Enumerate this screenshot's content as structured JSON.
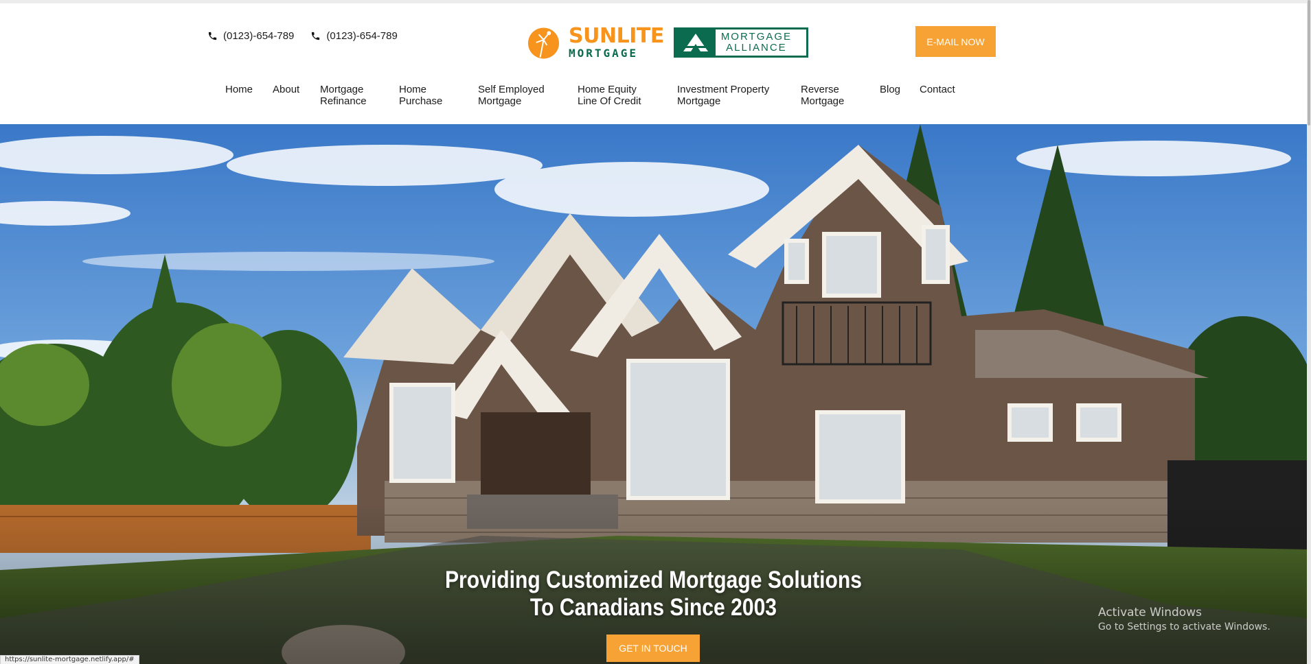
{
  "topbar": {
    "phones": [
      "(0123)-654-789",
      "(0123)-654-789"
    ],
    "logo": {
      "name_top": "SUNLITE",
      "name_bottom": "MORTGAGE",
      "partner_line1": "MORTGAGE",
      "partner_line2": "ALLIANCE"
    },
    "email_button": "E-MAIL NOW"
  },
  "nav": {
    "items": [
      {
        "line1": "Home",
        "line2": ""
      },
      {
        "line1": "About",
        "line2": ""
      },
      {
        "line1": "Mortgage",
        "line2": "Refinance"
      },
      {
        "line1": "Home",
        "line2": "Purchase"
      },
      {
        "line1": "Self Employed",
        "line2": "Mortgage"
      },
      {
        "line1": "Home Equity",
        "line2": "Line Of Credit"
      },
      {
        "line1": "Investment Property",
        "line2": "Mortgage"
      },
      {
        "line1": "Reverse",
        "line2": "Mortgage"
      },
      {
        "line1": "Blog",
        "line2": ""
      },
      {
        "line1": "Contact",
        "line2": ""
      }
    ]
  },
  "hero": {
    "headline_line1": "Providing Customized Mortgage Solutions",
    "headline_line2": "To Canadians Since 2003",
    "cta": "GET IN TOUCH"
  },
  "os_watermark": {
    "title": "Activate Windows",
    "subtitle": "Go to Settings to activate Windows."
  },
  "status_bar": {
    "url": "https://sunlite-mortgage.netlify.app/#"
  },
  "colors": {
    "accent_orange": "#f7a234",
    "brand_green": "#0b6b4f",
    "brand_orange": "#f7941d"
  }
}
